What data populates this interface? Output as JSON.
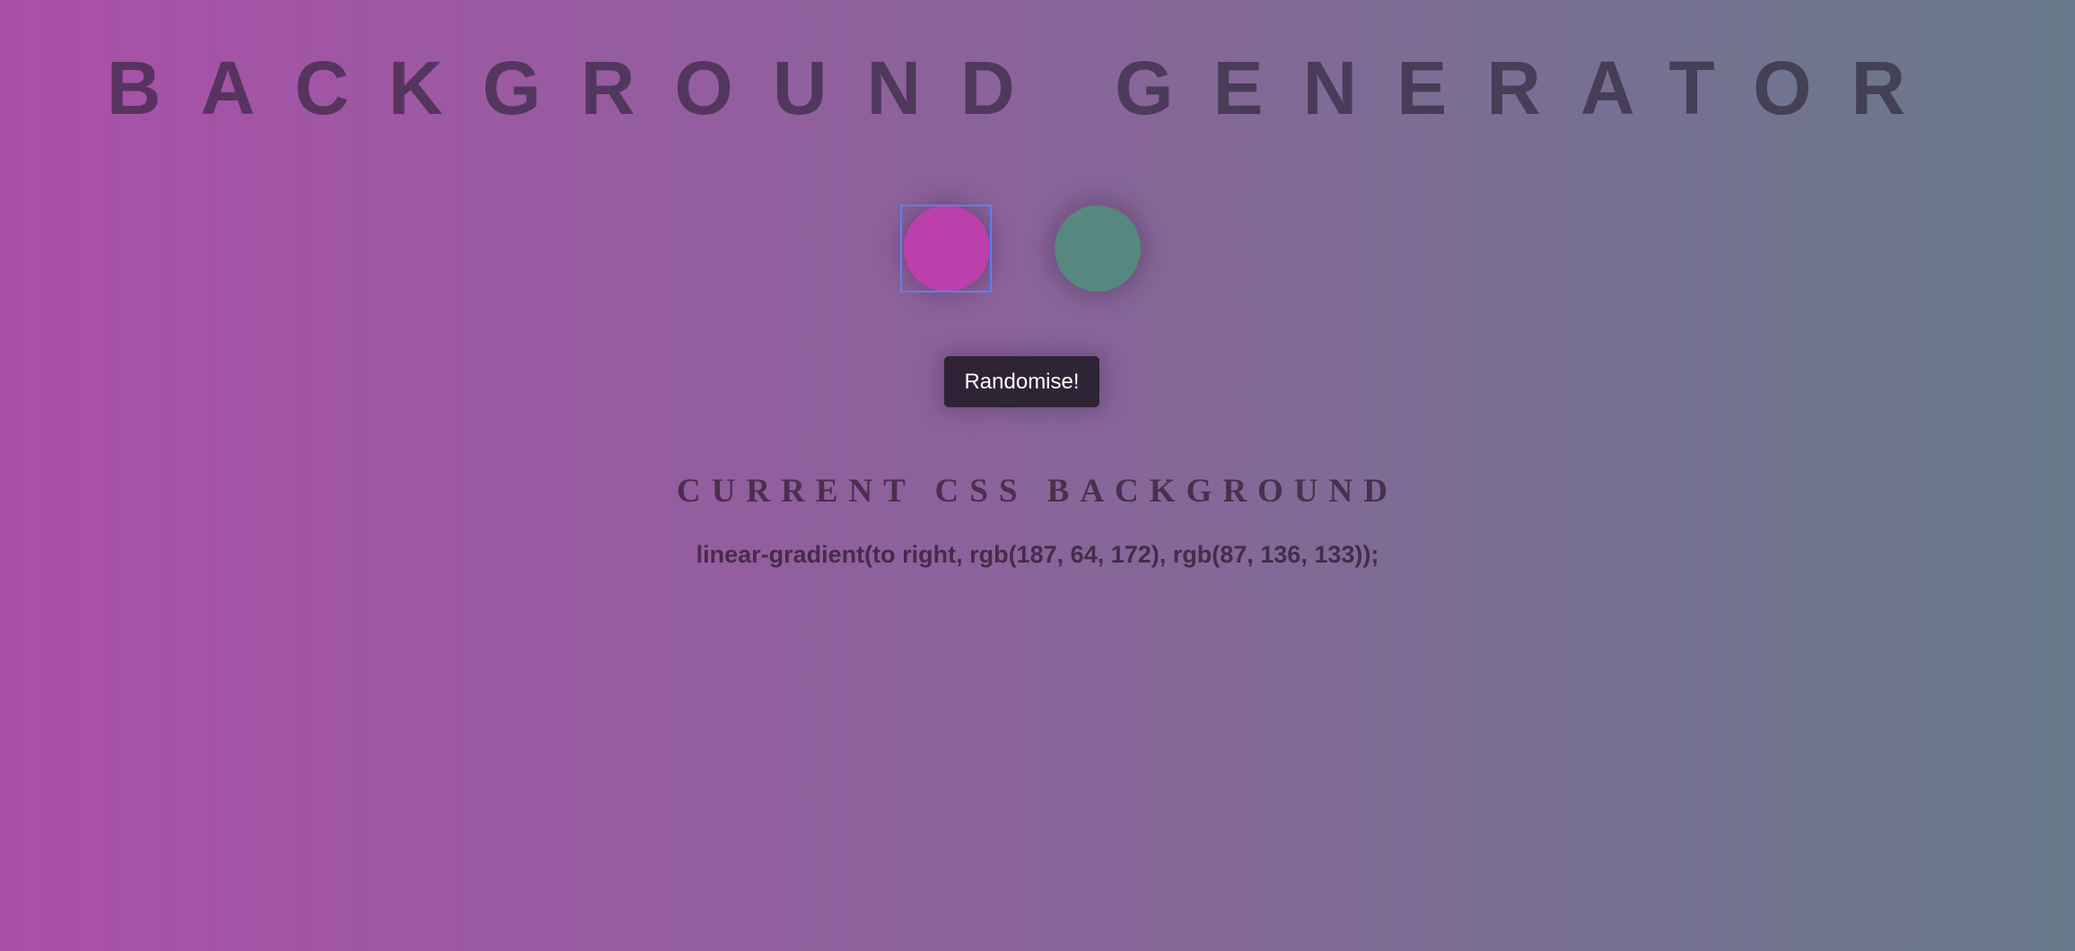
{
  "header": {
    "title": "BACKGROUND GENERATOR"
  },
  "color_pickers": {
    "color1": {
      "value": "#bb40ac"
    },
    "color2": {
      "value": "#57887f"
    },
    "focused": "color1"
  },
  "randomise_button": {
    "label": "Randomise!"
  },
  "current_css": {
    "heading": "CURRENT CSS BACKGROUND",
    "value": "linear-gradient(to right, rgb(187, 64, 172), rgb(87, 136, 133));"
  },
  "colors": {
    "gradient_start": "#aa4fa9",
    "gradient_end": "#687a8b",
    "button_bg": "#2e2435",
    "focus_ring": "#5b82e6"
  }
}
